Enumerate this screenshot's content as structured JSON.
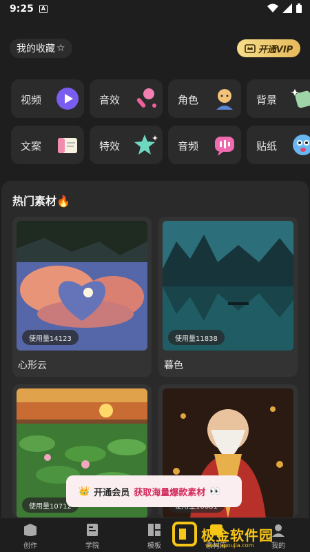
{
  "status": {
    "time": "9:25",
    "notif_badge": "A"
  },
  "header": {
    "favorites_label": "我的收藏",
    "favorites_star": "☆",
    "vip_label": "开通VIP"
  },
  "categories": [
    {
      "label": "视频",
      "icon": "play-icon"
    },
    {
      "label": "音效",
      "icon": "microphone-icon"
    },
    {
      "label": "角色",
      "icon": "character-icon"
    },
    {
      "label": "背景",
      "icon": "gem-icon"
    },
    {
      "label": "文案",
      "icon": "notebook-icon"
    },
    {
      "label": "特效",
      "icon": "sparkle-star-icon"
    },
    {
      "label": "音频",
      "icon": "audio-speech-icon"
    },
    {
      "label": "贴纸",
      "icon": "ghost-sticker-icon"
    }
  ],
  "hot": {
    "title": "热门素材",
    "title_emoji": "🔥",
    "items": [
      {
        "name": "心形云",
        "usage": "使用量14123"
      },
      {
        "name": "暮色",
        "usage": "使用量11838"
      },
      {
        "name": "",
        "usage": "使用量10712"
      },
      {
        "name": "",
        "usage": "使用量10681"
      }
    ]
  },
  "toast": {
    "crown": "👑",
    "prefix": "开通会员",
    "highlight": "获取海量爆款素材",
    "eyes": "👀"
  },
  "nav": [
    {
      "label": "创作",
      "icon": "create-icon"
    },
    {
      "label": "学院",
      "icon": "academy-icon"
    },
    {
      "label": "模板",
      "icon": "template-icon"
    },
    {
      "label": "素材库",
      "icon": "material-icon"
    },
    {
      "label": "我的",
      "icon": "profile-icon"
    }
  ],
  "watermark": {
    "text": "极金软件园",
    "url": "www.apoujia.com"
  }
}
